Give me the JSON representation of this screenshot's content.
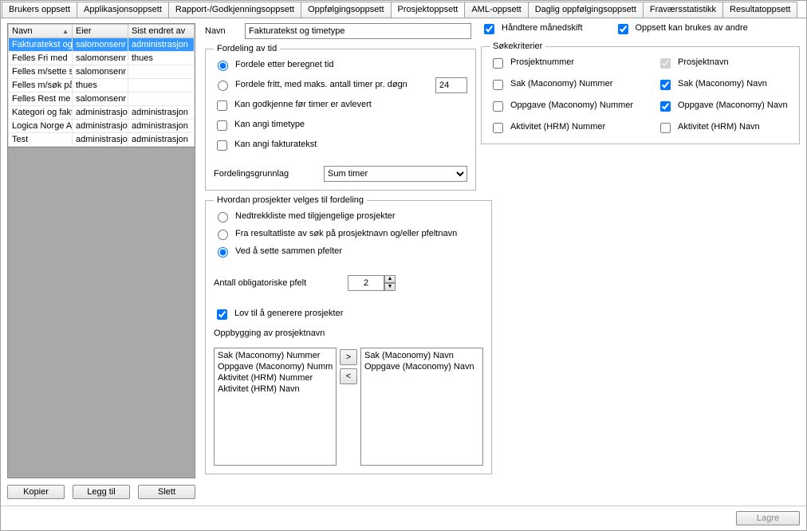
{
  "tabs": [
    "Brukers oppsett",
    "Applikasjonsoppsett",
    "Rapport-/Godkjenningsoppsett",
    "Oppfølgingsoppsett",
    "Prosjektoppsett",
    "AML-oppsett",
    "Daglig oppfølgingsoppsett",
    "Fraværsstatistikk",
    "Resultatoppsett"
  ],
  "active_tab_index": 4,
  "grid": {
    "columns": [
      "Navn",
      "Eier",
      "Sist endret av"
    ],
    "rows": [
      {
        "navn": "Fakturatekst og",
        "eier": "salomonsenr",
        "sist": "administrasjon",
        "selected": true
      },
      {
        "navn": "Felles Fri med",
        "eier": "salomonsenr",
        "sist": "thues"
      },
      {
        "navn": "Felles m/sette s",
        "eier": "salomonsenr",
        "sist": ""
      },
      {
        "navn": "Felles m/søk på",
        "eier": "thues",
        "sist": ""
      },
      {
        "navn": "Felles Rest me",
        "eier": "salomonsenr",
        "sist": ""
      },
      {
        "navn": "Kategori og fakt",
        "eier": "administrasjo",
        "sist": "administrasjon"
      },
      {
        "navn": "Logica Norge A",
        "eier": "administrasjo",
        "sist": "administrasjon"
      },
      {
        "navn": "Test",
        "eier": "administrasjo",
        "sist": "administrasjon"
      }
    ]
  },
  "buttons": {
    "kopier": "Kopier",
    "leggtil": "Legg til",
    "slett": "Slett",
    "lagre": "Lagre"
  },
  "form": {
    "navn_label": "Navn",
    "navn_value": "Fakturatekst og timetype",
    "fieldset_fordeling": "Fordeling av tid",
    "opt_beregnet": "Fordele etter beregnet tid",
    "opt_fritt": "Fordele fritt, med maks. antall timer pr. døgn",
    "fritt_value": "24",
    "chk_godkjenne": "Kan godkjenne før timer er avlevert",
    "chk_timetype": "Kan angi timetype",
    "chk_faktura": "Kan angi fakturatekst",
    "fordelingsgrunnlag_label": "Fordelingsgrunnlag",
    "fordelingsgrunnlag_value": "Sum timer",
    "fieldset_hvordan": "Hvordan prosjekter velges til fordeling",
    "opt_nedtrekk": "Nedtrekkliste med tilgjengelige prosjekter",
    "opt_resultat": "Fra resultatliste av søk på prosjektnavn og/eller pfeltnavn",
    "opt_sammen": "Ved å sette sammen pfelter",
    "antall_label": "Antall obligatoriske pfelt",
    "antall_value": "2",
    "chk_generere": "Lov til å generere prosjekter",
    "oppbygging_label": "Oppbygging av prosjektnavn",
    "left_list": [
      "Sak (Maconomy) Nummer",
      "Oppgave (Maconomy) Numm",
      "Aktivitet (HRM) Nummer",
      "Aktivitet (HRM) Navn"
    ],
    "right_list": [
      "Sak (Maconomy) Navn",
      "Oppgave (Maconomy) Navn"
    ]
  },
  "topchecks": {
    "handtere": "Håndtere månedskift",
    "brukes": "Oppsett kan brukes av andre"
  },
  "searchcrit": {
    "legend": "Søkekriterier",
    "prosjektnummer": "Prosjektnummer",
    "prosjektnavn": "Prosjektnavn",
    "sak_nummer": "Sak (Maconomy) Nummer",
    "sak_navn": "Sak (Maconomy) Navn",
    "oppgave_nummer": "Oppgave (Maconomy) Nummer",
    "oppgave_navn": "Oppgave (Maconomy) Navn",
    "aktivitet_nummer": "Aktivitet (HRM) Nummer",
    "aktivitet_navn": "Aktivitet (HRM) Navn"
  }
}
